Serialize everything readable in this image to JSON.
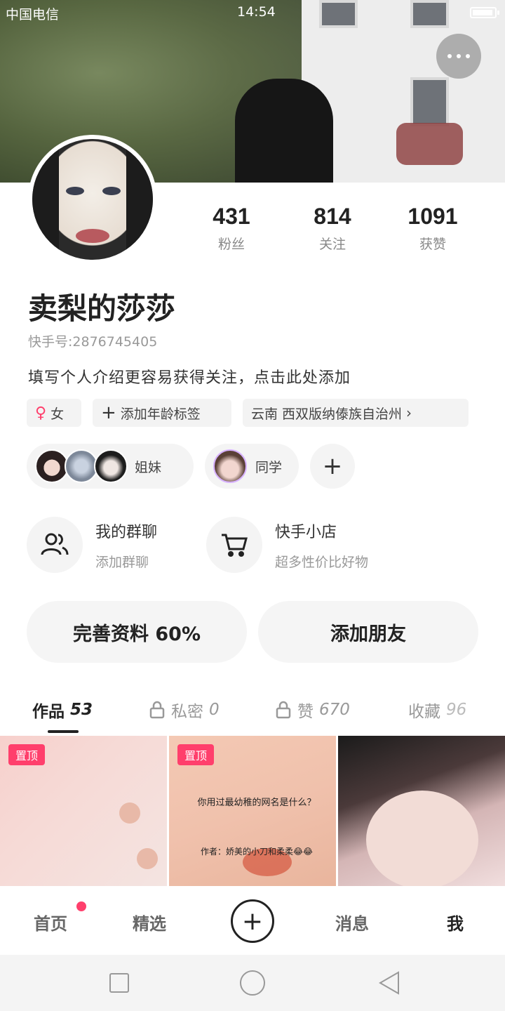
{
  "status_bar": {
    "carrier": "中国电信",
    "time": "14:54"
  },
  "profile": {
    "username": "卖梨的莎莎",
    "kwai_id": "快手号:2876745405",
    "bio": "填写个人介绍更容易获得关注，点击此处添加",
    "stats": [
      {
        "num": "431",
        "label": "粉丝"
      },
      {
        "num": "814",
        "label": "关注"
      },
      {
        "num": "1091",
        "label": "获赞"
      }
    ]
  },
  "tags": {
    "gender_icon": "female-icon",
    "gender": "女",
    "age_tag": "添加年龄标签",
    "location": "云南 西双版纳傣族自治州"
  },
  "groups": [
    {
      "label": "姐妹"
    },
    {
      "label": "同学"
    }
  ],
  "features": {
    "group_chat": {
      "title": "我的群聊",
      "subtitle": "添加群聊"
    },
    "shop": {
      "title": "快手小店",
      "subtitle": "超多性价比好物"
    }
  },
  "buttons": {
    "complete_profile": "完善资料 60%",
    "add_friend": "添加朋友"
  },
  "tabs": [
    {
      "label": "作品",
      "count": "53"
    },
    {
      "label": "私密",
      "count": "0"
    },
    {
      "label": "赞",
      "count": "670"
    },
    {
      "label": "收藏",
      "count": "96"
    }
  ],
  "videos": [
    {
      "pinned": "置顶"
    },
    {
      "pinned": "置顶",
      "caption": "你用过最幼稚的网名是什么？",
      "author": "作者：娇美的小刀和柔柔😂😂"
    },
    {}
  ],
  "bottom_nav": {
    "home": "首页",
    "featured": "精选",
    "messages": "消息",
    "me": "我"
  },
  "colors": {
    "accent": "#ff3f6c",
    "text": "#222222",
    "muted": "#999999",
    "pill_bg": "#f4f4f4"
  }
}
